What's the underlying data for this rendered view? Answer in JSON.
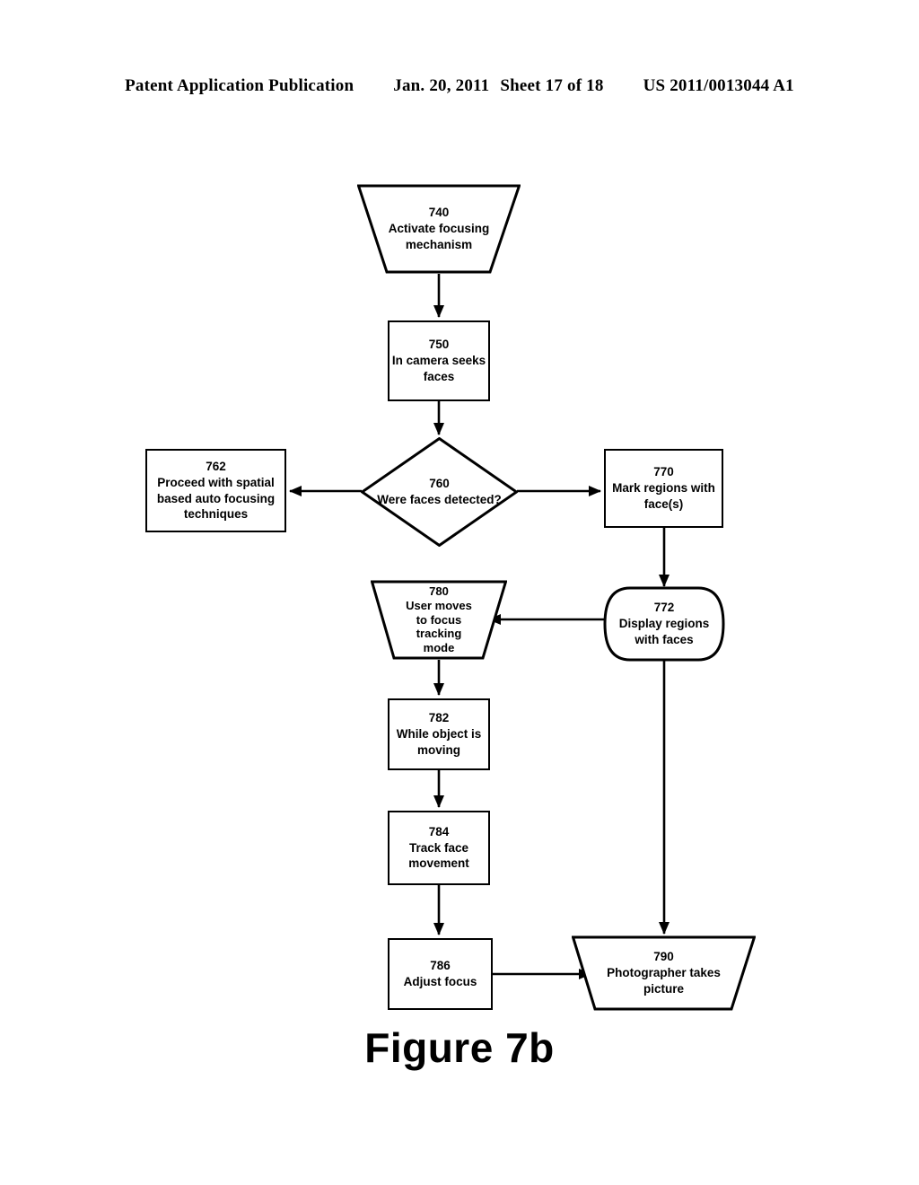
{
  "header": {
    "publication": "Patent Application Publication",
    "date": "Jan. 20, 2011",
    "sheet": "Sheet 17 of 18",
    "patent_number": "US 2011/0013044 A1"
  },
  "figure": {
    "caption": "Figure 7b"
  },
  "colors": {
    "stroke": "#000000",
    "fill": "#ffffff",
    "text": "#000000"
  },
  "diagram": {
    "type": "flowchart",
    "nodes": [
      {
        "id": "740",
        "shape": "trapezoid",
        "number": "740",
        "label": "Activate focusing\nmechanism"
      },
      {
        "id": "750",
        "shape": "rectangle",
        "number": "750",
        "label": "In camera seeks\nfaces"
      },
      {
        "id": "760",
        "shape": "diamond",
        "number": "760",
        "label": "Were faces detected?"
      },
      {
        "id": "762",
        "shape": "rectangle",
        "number": "762",
        "label": "Proceed with spatial\nbased auto focusing\ntechniques"
      },
      {
        "id": "770",
        "shape": "rectangle",
        "number": "770",
        "label": "Mark regions with\nface(s)"
      },
      {
        "id": "772",
        "shape": "stadium",
        "number": "772",
        "label": "Display regions\nwith faces"
      },
      {
        "id": "780",
        "shape": "trapezoid",
        "number": "780",
        "label": "User moves\nto focus\ntracking\nmode"
      },
      {
        "id": "782",
        "shape": "rectangle",
        "number": "782",
        "label": "While object is\nmoving"
      },
      {
        "id": "784",
        "shape": "rectangle",
        "number": "784",
        "label": "Track face\nmovement"
      },
      {
        "id": "786",
        "shape": "rectangle",
        "number": "786",
        "label": "Adjust focus"
      },
      {
        "id": "790",
        "shape": "trapezoid",
        "number": "790",
        "label": "Photographer takes\npicture"
      }
    ],
    "edges": [
      {
        "from": "740",
        "to": "750",
        "direction": "down"
      },
      {
        "from": "750",
        "to": "760",
        "direction": "down"
      },
      {
        "from": "760",
        "to": "762",
        "direction": "left"
      },
      {
        "from": "760",
        "to": "770",
        "direction": "right"
      },
      {
        "from": "770",
        "to": "772",
        "direction": "down"
      },
      {
        "from": "772",
        "to": "780",
        "direction": "left"
      },
      {
        "from": "780",
        "to": "782",
        "direction": "down"
      },
      {
        "from": "782",
        "to": "784",
        "direction": "down"
      },
      {
        "from": "784",
        "to": "786",
        "direction": "down"
      },
      {
        "from": "786",
        "to": "790",
        "direction": "right"
      },
      {
        "from": "772",
        "to": "790",
        "direction": "down"
      }
    ]
  }
}
